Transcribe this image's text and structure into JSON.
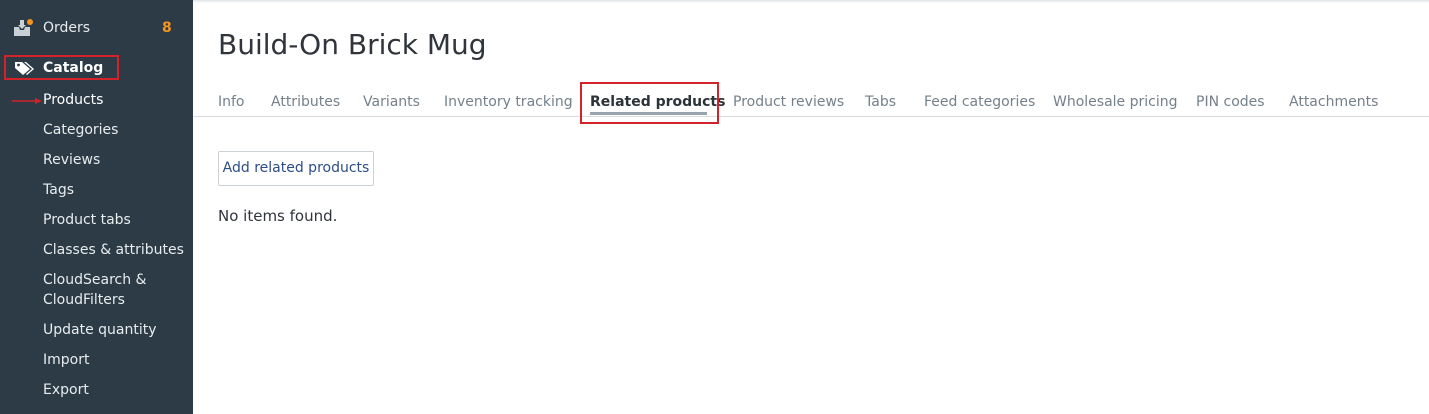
{
  "sidebar": {
    "orders": {
      "label": "Orders",
      "count": "8",
      "icon": "orders-box-icon"
    },
    "catalog": {
      "label": "Catalog",
      "icon": "tags-icon"
    },
    "items": [
      {
        "label": "Products"
      },
      {
        "label": "Categories"
      },
      {
        "label": "Reviews"
      },
      {
        "label": "Tags"
      },
      {
        "label": "Product tabs"
      },
      {
        "label": "Classes & attributes"
      },
      {
        "label": "CloudSearch & CloudFilters"
      },
      {
        "label": "Update quantity"
      },
      {
        "label": "Import"
      },
      {
        "label": "Export"
      }
    ]
  },
  "main": {
    "title": "Build-On Brick Mug",
    "tabs": [
      {
        "label": "Info"
      },
      {
        "label": "Attributes"
      },
      {
        "label": "Variants"
      },
      {
        "label": "Inventory tracking"
      },
      {
        "label": "Related products",
        "active": true
      },
      {
        "label": "Product reviews"
      },
      {
        "label": "Tabs"
      },
      {
        "label": "Feed categories"
      },
      {
        "label": "Wholesale pricing"
      },
      {
        "label": "PIN codes"
      },
      {
        "label": "Attachments"
      }
    ],
    "add_button_label": "Add related products",
    "empty_message": "No items found."
  },
  "colors": {
    "sidebar_bg": "#2c3b45",
    "accent_orange": "#f7941d",
    "highlight_red": "#d3222a",
    "link_blue": "#2c4d86"
  }
}
